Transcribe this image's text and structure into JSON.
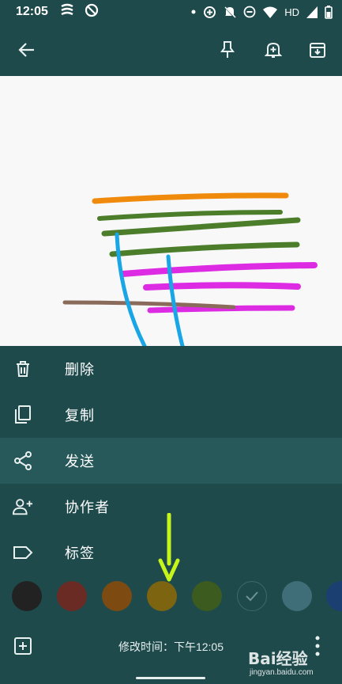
{
  "status_bar": {
    "time": "12:05",
    "network_label": "HD"
  },
  "toolbar": {
    "back_icon": "arrow-left-icon",
    "pin_icon": "pin-icon",
    "reminder_icon": "bell-plus-icon",
    "archive_icon": "archive-icon"
  },
  "drawing": {
    "stroke_colors": [
      "#f08a0c",
      "#4b7d2a",
      "#dd2be4",
      "#8a6a5a",
      "#19a6e6"
    ]
  },
  "menu": {
    "items": [
      {
        "label": "删除",
        "icon": "trash-icon"
      },
      {
        "label": "复制",
        "icon": "copy-icon"
      },
      {
        "label": "发送",
        "icon": "share-icon"
      },
      {
        "label": "协作者",
        "icon": "person-add-icon"
      },
      {
        "label": "标签",
        "icon": "label-icon"
      }
    ],
    "active_item": "发送"
  },
  "colors": {
    "swatches": [
      "#222222",
      "#6b2b25",
      "#7d4a12",
      "#7d6410",
      "#3c5c1f",
      "#1f4a4c",
      "#3f6e78",
      "#1b3f70"
    ],
    "selected_index": 5
  },
  "footer": {
    "modified_text": "修改时间：下午12:05",
    "add_icon": "add-box-icon",
    "more_icon": "more-vert-icon"
  },
  "annotation": {
    "arrow_color": "#c6f51c"
  },
  "watermark": {
    "brand": "Bai经验",
    "url": "jingyan.baidu.com"
  }
}
